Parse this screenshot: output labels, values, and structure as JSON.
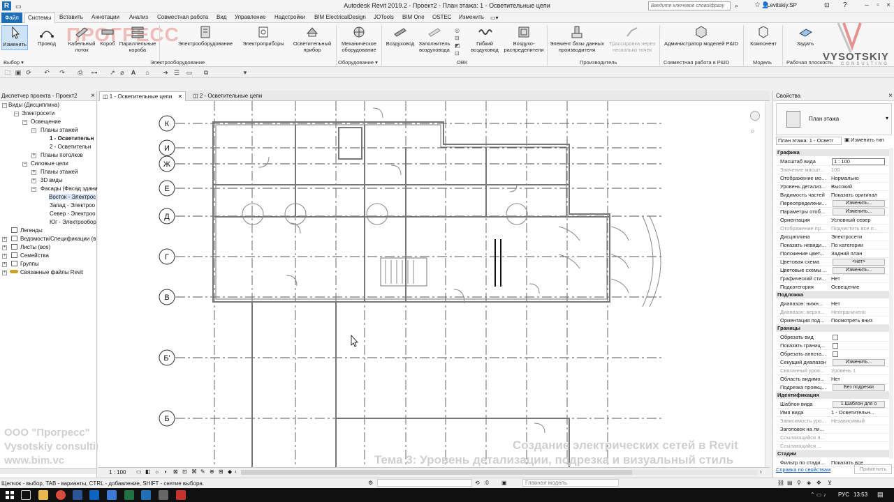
{
  "window": {
    "title": "Autodesk Revit 2019.2 - Проект2 - План этажа: 1 - Осветительные цепи",
    "search_placeholder": "Введите ключевое слово/фразу",
    "user": "Levitskiy.SP"
  },
  "menu": {
    "file": "Файл",
    "tabs": [
      "Системы",
      "Вставить",
      "Аннотации",
      "Анализ",
      "Совместная работа",
      "Вид",
      "Управление",
      "Надстройки",
      "BIM ElectricalDesign",
      "JOTools",
      "BIM One",
      "OSTEC",
      "Изменить"
    ],
    "active_index": 0
  },
  "ribbon": {
    "buttons": [
      {
        "label": "Изменить",
        "icon": "cursor-icon"
      },
      {
        "label": "Провод",
        "icon": "wire-icon"
      },
      {
        "label": "Кабельный лоток",
        "icon": "cable-tray-icon"
      },
      {
        "label": "Короб",
        "icon": "conduit-icon"
      },
      {
        "label": "Параллельные короба",
        "icon": "parallel-conduits-icon"
      },
      {
        "label": "Электрооборудование",
        "icon": "electrical-equipment-icon"
      },
      {
        "label": "Электроприборы",
        "icon": "electrical-fixture-icon"
      },
      {
        "label": "Осветительный прибор",
        "icon": "lighting-fixture-icon"
      },
      {
        "label": "Механическое оборудование",
        "icon": "mechanical-equipment-icon"
      },
      {
        "label": "Воздуховод",
        "icon": "duct-icon"
      },
      {
        "label": "Заполнитель воздуховода",
        "icon": "duct-placeholder-icon"
      },
      {
        "label": "Гибкий воздуховод",
        "icon": "flex-duct-icon"
      },
      {
        "label": "Воздухо-распределители",
        "icon": "air-terminal-icon"
      },
      {
        "label": "Элемент базы данных производителя",
        "icon": "fabrication-part-icon"
      },
      {
        "label": "Трассировка через несколько точек",
        "icon": "multipoint-routing-icon"
      },
      {
        "label": "Администратор моделей P&ID",
        "icon": "pid-admin-icon"
      },
      {
        "label": "Компонент",
        "icon": "component-icon"
      },
      {
        "label": "Задать",
        "icon": "set-workplane-icon"
      }
    ],
    "panels": [
      "Выбор ▾",
      "Электрооборудование",
      "Оборудование ▾",
      "ОВК",
      "Производитель",
      "Совместная работа в P&ID",
      "Модель",
      "Рабочая плоскость"
    ]
  },
  "browser": {
    "title": "Диспетчер проекта - Проект2",
    "nodes": [
      {
        "label": "Виды (Дисциплина)",
        "bold": false
      },
      {
        "label": "Электросети",
        "bold": false
      },
      {
        "label": "Освещение",
        "bold": false
      },
      {
        "label": "Планы этажей",
        "bold": false
      },
      {
        "label": "1 - Осветительн",
        "bold": true
      },
      {
        "label": "2 - Осветительн",
        "bold": false
      },
      {
        "label": "Планы потолков",
        "bold": false
      },
      {
        "label": "Силовые цепи",
        "bold": false
      },
      {
        "label": "Планы этажей",
        "bold": false
      },
      {
        "label": "3D виды",
        "bold": false
      },
      {
        "label": "Фасады (Фасад здани",
        "bold": false
      },
      {
        "label": "Восток - Электрос",
        "bold": false
      },
      {
        "label": "Запад - Электроо",
        "bold": false
      },
      {
        "label": "Север - Электроо",
        "bold": false
      },
      {
        "label": "Юг - Электрообор",
        "bold": false
      },
      {
        "label": "Легенды",
        "bold": false
      },
      {
        "label": "Ведомости/Спецификации (в",
        "bold": false
      },
      {
        "label": "Листы (все)",
        "bold": false
      },
      {
        "label": "Семейства",
        "bold": false
      },
      {
        "label": "Группы",
        "bold": false
      },
      {
        "label": "Связанные файлы Revit",
        "bold": false
      }
    ]
  },
  "view_tabs": [
    {
      "label": "1 - Осветительные цепи",
      "active": true
    },
    {
      "label": "2 - Осветительные цепи",
      "active": false
    }
  ],
  "grid_labels": [
    "К",
    "И",
    "Ж",
    "Е",
    "Д",
    "Г",
    "В",
    "Б'",
    "Б"
  ],
  "view_scale": "1 : 100",
  "properties": {
    "title": "Свойства",
    "type_name": "План этажа",
    "selector": "План этажа: 1 - Осветг",
    "edit_type": "Изменить тип",
    "groups": [
      {
        "name": "Графика",
        "rows": [
          {
            "k": "Масштаб вида",
            "v": "1 : 100",
            "kind": "input"
          },
          {
            "k": "Значение масшт...",
            "v": "100",
            "kind": "dim"
          },
          {
            "k": "Отображение мо...",
            "v": "Нормально"
          },
          {
            "k": "Уровень детализ...",
            "v": "Высокий"
          },
          {
            "k": "Видимость частей",
            "v": "Показать оригинал"
          },
          {
            "k": "Переопределени...",
            "v": "Изменить...",
            "kind": "button"
          },
          {
            "k": "Параметры отоб...",
            "v": "Изменить...",
            "kind": "button"
          },
          {
            "k": "Ориентация",
            "v": "Условный север"
          },
          {
            "k": "Отображение пр...",
            "v": "Подчистить все п...",
            "kind": "dim"
          },
          {
            "k": "Дисциплина",
            "v": "Электросети"
          },
          {
            "k": "Показать невиди...",
            "v": "По категории"
          },
          {
            "k": "Положение цвет...",
            "v": "Задний план"
          },
          {
            "k": "Цветовая схема",
            "v": "<нет>",
            "kind": "button"
          },
          {
            "k": "Цветовые схемы ...",
            "v": "Изменить...",
            "kind": "button"
          },
          {
            "k": "Графический сти...",
            "v": "Нет"
          },
          {
            "k": "Подкатегория",
            "v": "Освещение"
          }
        ]
      },
      {
        "name": "Подложка",
        "rows": [
          {
            "k": "Диапазон: нижн...",
            "v": "Нет"
          },
          {
            "k": "Диапазон: верхн...",
            "v": "Неограничено",
            "kind": "dim"
          },
          {
            "k": "Ориентация под...",
            "v": "Посмотреть вниз"
          }
        ]
      },
      {
        "name": "Границы",
        "rows": [
          {
            "k": "Обрезать вид",
            "v": "",
            "kind": "check"
          },
          {
            "k": "Показать границ...",
            "v": "",
            "kind": "check"
          },
          {
            "k": "Обрезать аннота...",
            "v": "",
            "kind": "check"
          },
          {
            "k": "Секущий диапазон",
            "v": "Изменить...",
            "kind": "button"
          },
          {
            "k": "Связанный уров...",
            "v": "Уровень 1",
            "kind": "dim"
          },
          {
            "k": "Область видимо...",
            "v": "Нет"
          },
          {
            "k": "Подрезка проекц...",
            "v": "Без подрезки",
            "kind": "button"
          }
        ]
      },
      {
        "name": "Идентификация",
        "rows": [
          {
            "k": "Шаблон вида",
            "v": "1.Шаблон для о",
            "kind": "button"
          },
          {
            "k": "Имя вида",
            "v": "1 - Осветительн..."
          },
          {
            "k": "Зависимость уро...",
            "v": "Независимый",
            "kind": "dim"
          },
          {
            "k": "Заголовок на ли...",
            "v": ""
          },
          {
            "k": "Ссылающийся л...",
            "v": "",
            "kind": "dim"
          },
          {
            "k": "Ссылающийся ...",
            "v": "",
            "kind": "dim"
          }
        ]
      },
      {
        "name": "Стадии",
        "rows": [
          {
            "k": "Фильтр по стади...",
            "v": "Показать все"
          }
        ]
      }
    ],
    "help_link": "Справка по свойствам",
    "apply": "Применить"
  },
  "status": {
    "hint": "Щелчок - выбор, TAB - варианты, CTRL - добавление, SHIFT - снятие выбора.",
    "zero": ":0",
    "model": "Главная модель"
  },
  "taskbar": {
    "lang": "РУС",
    "time": "13:53"
  },
  "watermarks": {
    "logo": "ПРОГРЕСС",
    "vysotskiy": "VYSOTSKIY",
    "consulting": "CONSULTING",
    "company1": "ООО \"Прогресс\"",
    "company2": "Vysotskiy consulting",
    "site": "www.bim.vc",
    "course": "Создание электрических сетей в Revit",
    "topic": "Тема 3: Уровень детализации, подрезка и визуальный стиль"
  },
  "colors": {
    "file_tab": "#1e6fb5",
    "selection": "#cfe3f7",
    "plan_line": "#5a5a5a"
  }
}
